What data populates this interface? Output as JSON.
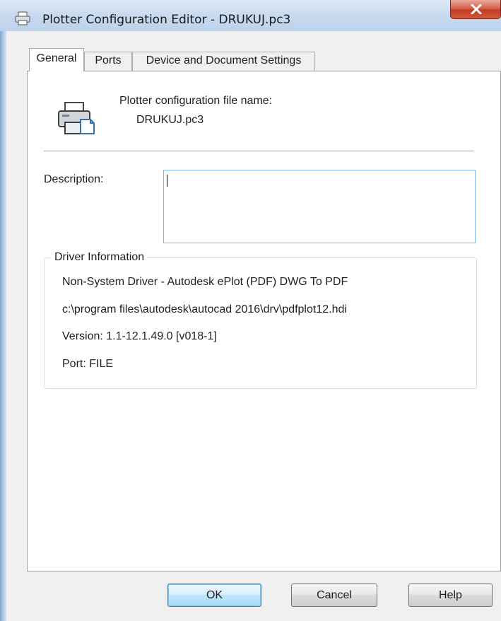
{
  "window": {
    "title": "Plotter Configuration Editor - DRUKUJ.pc3"
  },
  "tabs": [
    {
      "label": "General",
      "selected": true
    },
    {
      "label": "Ports",
      "selected": false
    },
    {
      "label": "Device and Document Settings",
      "selected": false
    }
  ],
  "general": {
    "file_name_label": "Plotter configuration file name:",
    "file_name_value": "DRUKUJ.pc3",
    "description_label": "Description:",
    "description_value": "",
    "driver_group_title": "Driver Information",
    "driver_lines": [
      "Non-System Driver - Autodesk ePlot (PDF) DWG To PDF",
      "c:\\program files\\autodesk\\autocad 2016\\drv\\pdfplot12.hdi",
      "Version: 1.1-12.1.49.0 [v018-1]",
      "Port: FILE"
    ]
  },
  "buttons": {
    "ok": "OK",
    "cancel": "Cancel",
    "help": "Help"
  },
  "icons": {
    "title": "printer-icon",
    "close": "close-icon",
    "plotter": "plotter-icon"
  },
  "colors": {
    "close_button": "#c33c24",
    "default_button_border": "#3c7fb1",
    "input_focus_border": "#7eb4ea"
  }
}
